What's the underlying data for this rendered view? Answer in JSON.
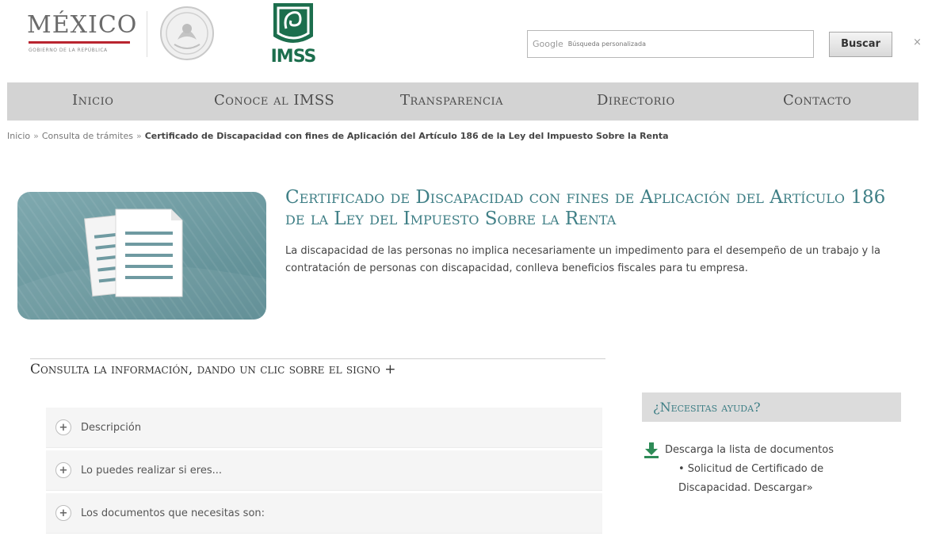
{
  "header": {
    "gov_logo_word": "MÉXICO",
    "gov_logo_sub": "GOBIERNO DE LA REPÚBLICA",
    "imss_logo_word": "IMSS",
    "search": {
      "google_label": "Google",
      "placeholder": "Búsqueda personalizada",
      "button_label": "Buscar",
      "close_label": "×"
    }
  },
  "nav": {
    "items": [
      {
        "label": "Inicio"
      },
      {
        "label": "Conoce al IMSS"
      },
      {
        "label": "Transparencia"
      },
      {
        "label": "Directorio"
      },
      {
        "label": "Contacto"
      }
    ]
  },
  "breadcrumb": {
    "items": [
      "Inicio",
      "Consulta de trámites"
    ],
    "separator": "»",
    "current": "Certificado de Discapacidad con fines de Aplicación del Artículo 186 de la Ley del Impuesto Sobre la Renta"
  },
  "hero": {
    "title": "Certificado de Discapacidad con fines de Aplicación del Artículo 186 de la Ley del Impuesto Sobre la Renta",
    "description": "La discapacidad de las personas no implica necesariamente un impedimento para el desempeño de un trabajo y la contratación de personas con discapacidad, conlleva beneficios fiscales para tu empresa."
  },
  "consulta": {
    "title": "Consulta la información, dando un clic sobre el signo +",
    "items": [
      {
        "label": "Descripción"
      },
      {
        "label": "Lo puedes realizar si eres..."
      },
      {
        "label": "Los documentos que necesitas son:"
      }
    ]
  },
  "help": {
    "title": "¿Necesitas ayuda?",
    "download_label": "Descarga la lista de documentos",
    "items": [
      "• Solicitud de Certificado de Discapacidad. Descargar»"
    ]
  },
  "colors": {
    "accent": "#3f7f86",
    "nav_bg": "#d3d3d3",
    "imss_green": "#1c6e4d",
    "gov_red": "#b9242f"
  },
  "icons": [
    "seal-icon",
    "imss-logo-icon",
    "document-icon",
    "plus-icon",
    "download-icon"
  ]
}
